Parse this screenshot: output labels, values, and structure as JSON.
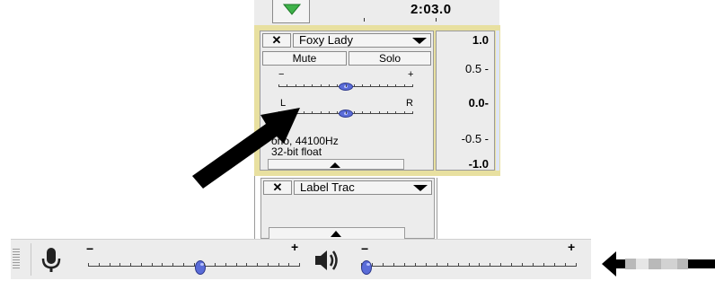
{
  "timeline": {
    "time_readout": "2:03.0"
  },
  "audio_track": {
    "close_label": "✕",
    "name": "Foxy Lady",
    "mute_label": "Mute",
    "solo_label": "Solo",
    "gain_minus": "−",
    "gain_plus": "+",
    "pan_left": "L",
    "pan_right": "R",
    "info_line1": "ono, 44100Hz",
    "info_line2": "32-bit float",
    "gain_level": 0.5,
    "pan_level": 0.5
  },
  "vertical_ruler": {
    "labels": [
      "1.0",
      "0.5 -",
      "0.0-",
      "-0.5 -",
      "-1.0"
    ]
  },
  "label_track": {
    "close_label": "✕",
    "name": "Label Trac"
  },
  "meter_toolbar": {
    "record_minus": "−",
    "record_plus": "+",
    "play_minus": "−",
    "play_plus": "+",
    "record_level": 0.53,
    "play_level": 0.0
  },
  "icons": {
    "collapse": "triangle-up-icon",
    "dropdown": "triangle-down-icon",
    "microphone": "microphone-icon",
    "speaker": "speaker-icon"
  },
  "colors": {
    "selected_track_border": "#e8e0a0",
    "slider_knob": "#5a6cd8",
    "panel_bg": "#ececec",
    "play_button_green": "#3fb24a"
  }
}
